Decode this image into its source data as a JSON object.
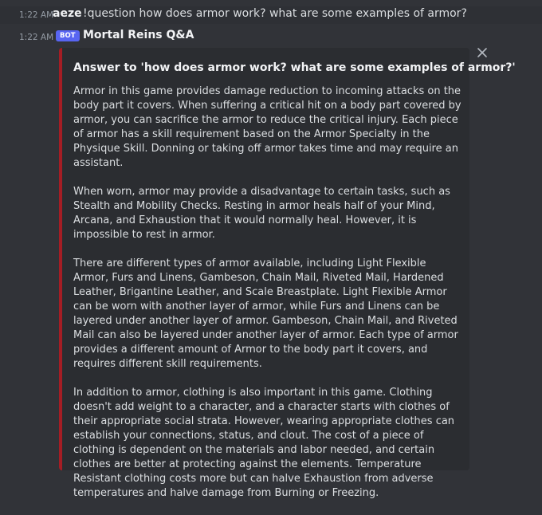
{
  "messages": [
    {
      "timestamp": "1:22 AM",
      "username": "aeze",
      "text": "!question how does armor work? what are some examples of armor?"
    },
    {
      "timestamp": "1:22 AM",
      "badge": "BOT",
      "username": "Mortal Reins Q&A"
    }
  ],
  "embed": {
    "accent_color": "#a51d24",
    "title": "Answer to 'how does armor work? what are some examples of armor?'",
    "paragraphs": [
      "Armor in this game provides damage reduction to incoming attacks on the body part it covers. When suffering a critical hit on a body part covered by armor, you can sacrifice the armor to reduce the critical injury. Each piece of armor has a skill requirement based on the Armor Specialty in the Physique Skill. Donning or taking off armor takes time and may require an assistant.",
      "When worn, armor may provide a disadvantage to certain tasks, such as Stealth and Mobility Checks. Resting in armor heals half of your Mind, Arcana, and Exhaustion that it would normally heal. However, it is impossible to rest in armor.",
      "There are different types of armor available, including Light Flexible Armor, Furs and Linens, Gambeson, Chain Mail, Riveted Mail, Hardened Leather, Brigantine Leather, and Scale Breastplate. Light Flexible Armor can be worn with another layer of armor, while Furs and Linens can be layered under another layer of armor. Gambeson, Chain Mail, and Riveted Mail can also be layered under another layer of armor. Each type of armor provides a different amount of Armor to the body part it covers, and requires different skill requirements.",
      "In addition to armor, clothing is also important in this game. Clothing doesn't add weight to a character, and a character starts with clothes of their appropriate social strata. However, wearing appropriate clothes can establish your connections, status, and clout. The cost of a piece of clothing is dependent on the materials and labor needed, and certain clothes are better at protecting against the elements. Temperature Resistant clothing costs more but can halve Exhaustion from adverse temperatures and halve damage from Burning or Freezing."
    ]
  },
  "icons": {
    "dismiss": "close-icon"
  }
}
